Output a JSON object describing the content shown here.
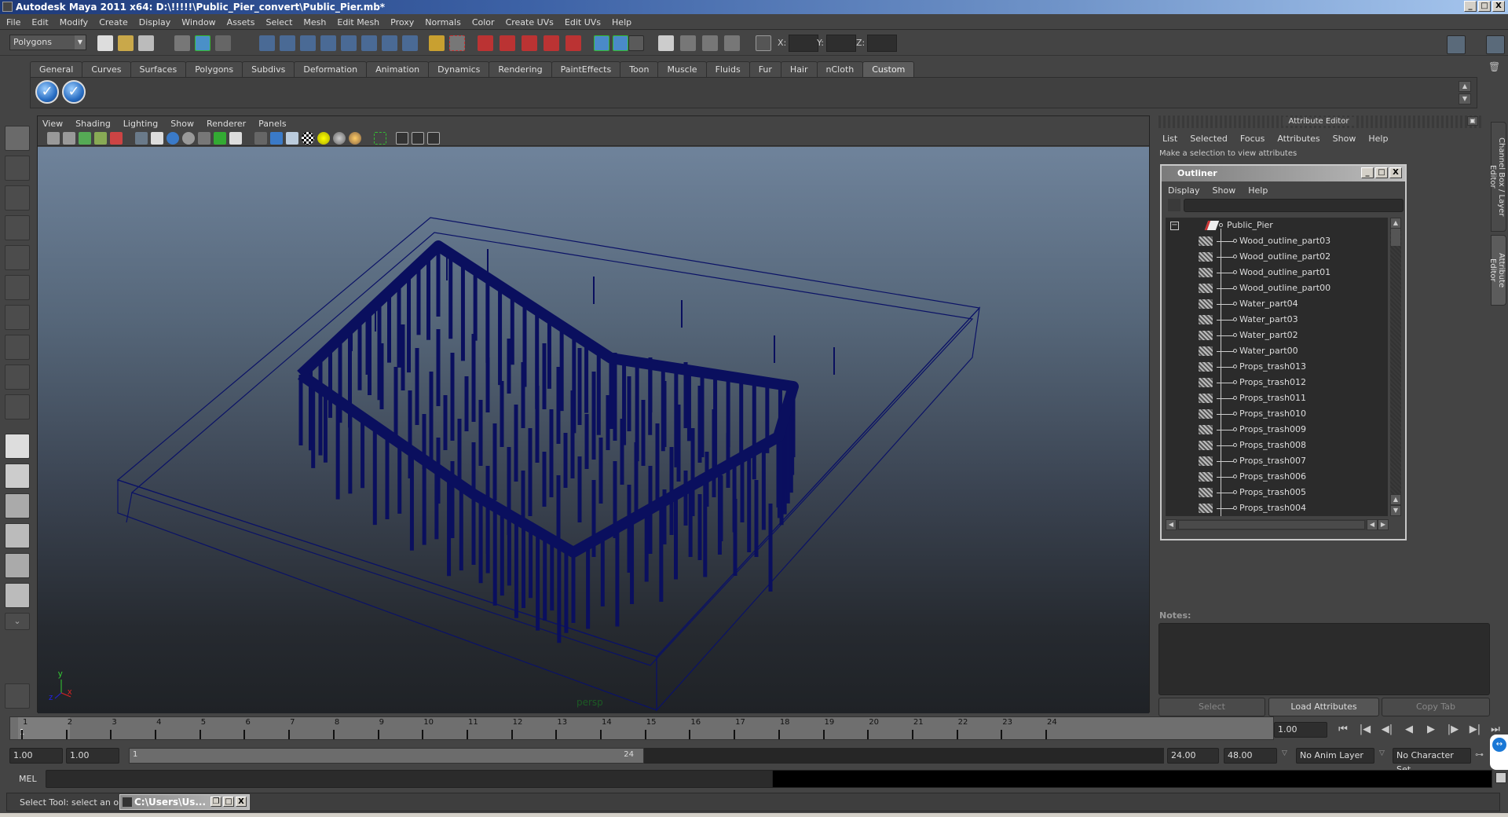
{
  "window": {
    "title": "Autodesk Maya 2011 x64: D:\\!!!!!\\Public_Pier_convert\\Public_Pier.mb*",
    "min": "_",
    "max": "□",
    "close": "X"
  },
  "menubar": [
    "File",
    "Edit",
    "Modify",
    "Create",
    "Display",
    "Window",
    "Assets",
    "Select",
    "Mesh",
    "Edit Mesh",
    "Proxy",
    "Normals",
    "Color",
    "Create UVs",
    "Edit UVs",
    "Help"
  ],
  "statusline": {
    "mode": "Polygons",
    "x_label": "X:",
    "y_label": "Y:",
    "z_label": "Z:"
  },
  "shelf": {
    "tabs": [
      "General",
      "Curves",
      "Surfaces",
      "Polygons",
      "Subdivs",
      "Deformation",
      "Animation",
      "Dynamics",
      "Rendering",
      "PaintEffects",
      "Toon",
      "Muscle",
      "Fluids",
      "Fur",
      "Hair",
      "nCloth",
      "Custom"
    ],
    "active_tab": "Custom",
    "buttons": [
      "✓",
      "✓"
    ]
  },
  "viewport": {
    "menu": [
      "View",
      "Shading",
      "Lighting",
      "Show",
      "Renderer",
      "Panels"
    ],
    "camera_label": "persp",
    "axis": {
      "x": "x",
      "y": "y",
      "z": "z"
    }
  },
  "attribute_editor": {
    "title": "Attribute Editor",
    "menu": [
      "List",
      "Selected",
      "Focus",
      "Attributes",
      "Show",
      "Help"
    ],
    "hint": "Make a selection to view attributes",
    "notes_label": "Notes:",
    "buttons": {
      "select": "Select",
      "load": "Load Attributes",
      "copy": "Copy Tab"
    }
  },
  "outliner": {
    "title": "Outliner",
    "menu": [
      "Display",
      "Show",
      "Help"
    ],
    "root": "Public_Pier",
    "items": [
      "Wood_outline_part03",
      "Wood_outline_part02",
      "Wood_outline_part01",
      "Wood_outline_part00",
      "Water_part04",
      "Water_part03",
      "Water_part02",
      "Water_part00",
      "Props_trash013",
      "Props_trash012",
      "Props_trash011",
      "Props_trash010",
      "Props_trash009",
      "Props_trash008",
      "Props_trash007",
      "Props_trash006",
      "Props_trash005",
      "Props_trash004"
    ]
  },
  "side_tabs": [
    "Channel Box / Layer Editor",
    "Attribute Editor"
  ],
  "timeline": {
    "ticks": [
      "1",
      "2",
      "3",
      "4",
      "5",
      "6",
      "7",
      "8",
      "9",
      "10",
      "11",
      "12",
      "13",
      "14",
      "15",
      "16",
      "17",
      "18",
      "19",
      "20",
      "21",
      "22",
      "23",
      "24"
    ],
    "current_marker": "1",
    "current_frame": "1.00",
    "playback_buttons": [
      "⏮",
      "|◀",
      "◀|",
      "◀",
      "▶",
      "|▶",
      "▶|",
      "⏭"
    ]
  },
  "range": {
    "start": "1.00",
    "anim_start": "1.00",
    "slider_start": "1",
    "slider_end": "24",
    "anim_end": "24.00",
    "end": "48.00",
    "anim_layer": "No Anim Layer",
    "character_set": "No Character Set"
  },
  "commandline": {
    "label": "MEL"
  },
  "helpline": {
    "text": "Select Tool: select an object",
    "task_window": "C:\\Users\\Us..."
  }
}
